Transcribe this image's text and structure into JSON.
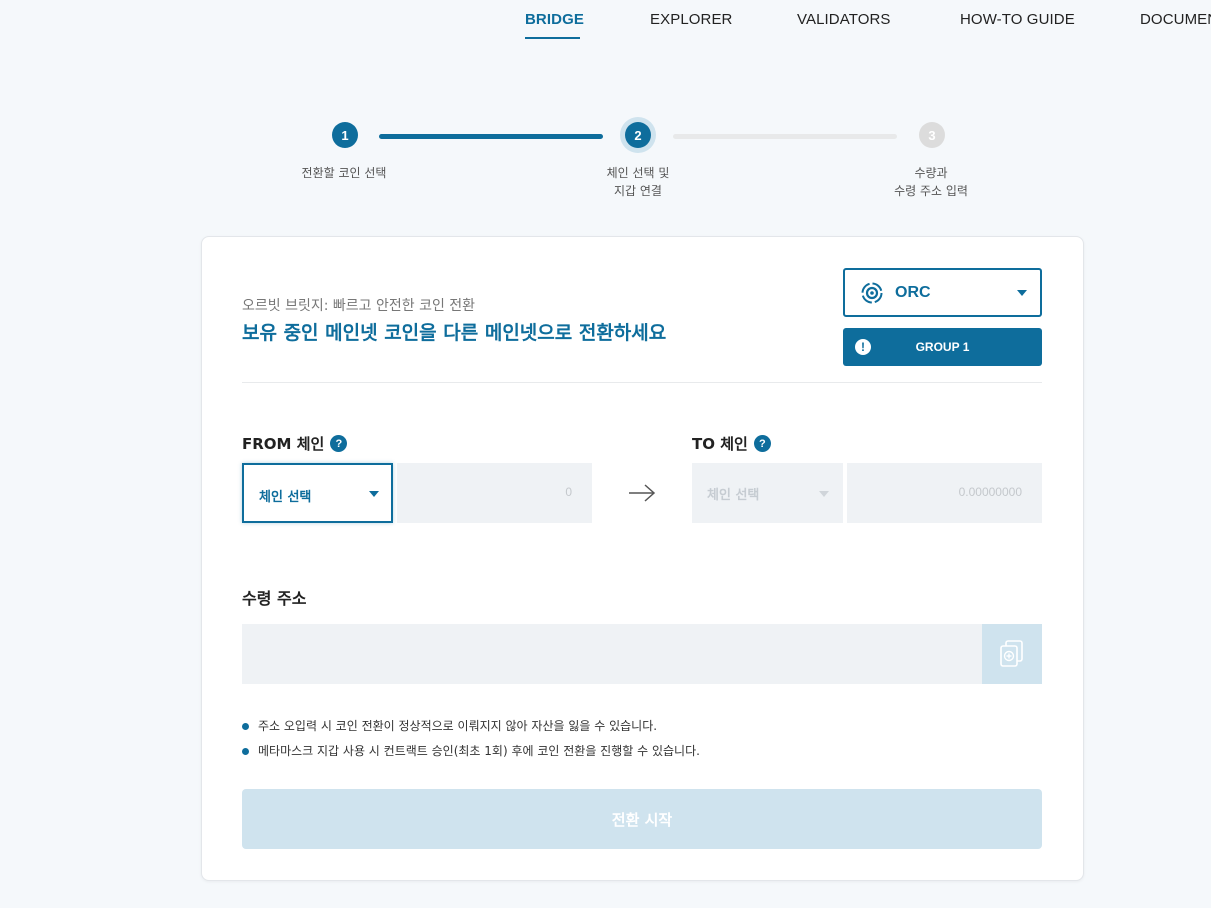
{
  "nav": {
    "items": [
      {
        "label": "BRIDGE",
        "active": true
      },
      {
        "label": "EXPLORER",
        "active": false
      },
      {
        "label": "VALIDATORS",
        "active": false
      },
      {
        "label": "HOW-TO GUIDE",
        "active": false
      },
      {
        "label": "DOCUMENTS",
        "active": false
      }
    ]
  },
  "stepper": {
    "steps": [
      {
        "number": "1",
        "label_line1": "전환할 코인 선택",
        "label_line2": "",
        "state": "done"
      },
      {
        "number": "2",
        "label_line1": "체인 선택 및",
        "label_line2": "지갑 연결",
        "state": "current"
      },
      {
        "number": "3",
        "label_line1": "수량과",
        "label_line2": "수령 주소 입력",
        "state": "todo"
      }
    ]
  },
  "card": {
    "subtitle": "오르빗 브릿지: 빠르고 안전한 코인 전환",
    "title": "보유 중인 메인넷 코인을 다른 메인넷으로 전환하세요",
    "coin_select": {
      "value": "ORC",
      "icon": "orbit-coin-icon"
    },
    "group_button": {
      "label": "GROUP 1",
      "icon": "alert-icon"
    },
    "from": {
      "label": "FROM 체인",
      "help": "?",
      "chain_placeholder": "체인 선택",
      "amount": "0"
    },
    "to": {
      "label": "TO 체인",
      "help": "?",
      "chain_placeholder": "체인 선택",
      "amount": "0.00000000"
    },
    "address": {
      "label": "수령 주소",
      "value": "",
      "placeholder": ""
    },
    "notes": [
      "주소 오입력 시 코인 전환이 정상적으로 이뤄지지 않아 자산을 잃을 수 있습니다.",
      "메타마스크 지갑 사용 시 컨트랙트 승인(최초 1회) 후에 코인 전환을 진행할 수 있습니다."
    ],
    "start_button": "전환 시작"
  },
  "colors": {
    "accent": "#0e6d9c",
    "accent_light": "#cfe3ee",
    "input_bg": "#eff2f5",
    "page_bg": "#f5f8fb"
  }
}
